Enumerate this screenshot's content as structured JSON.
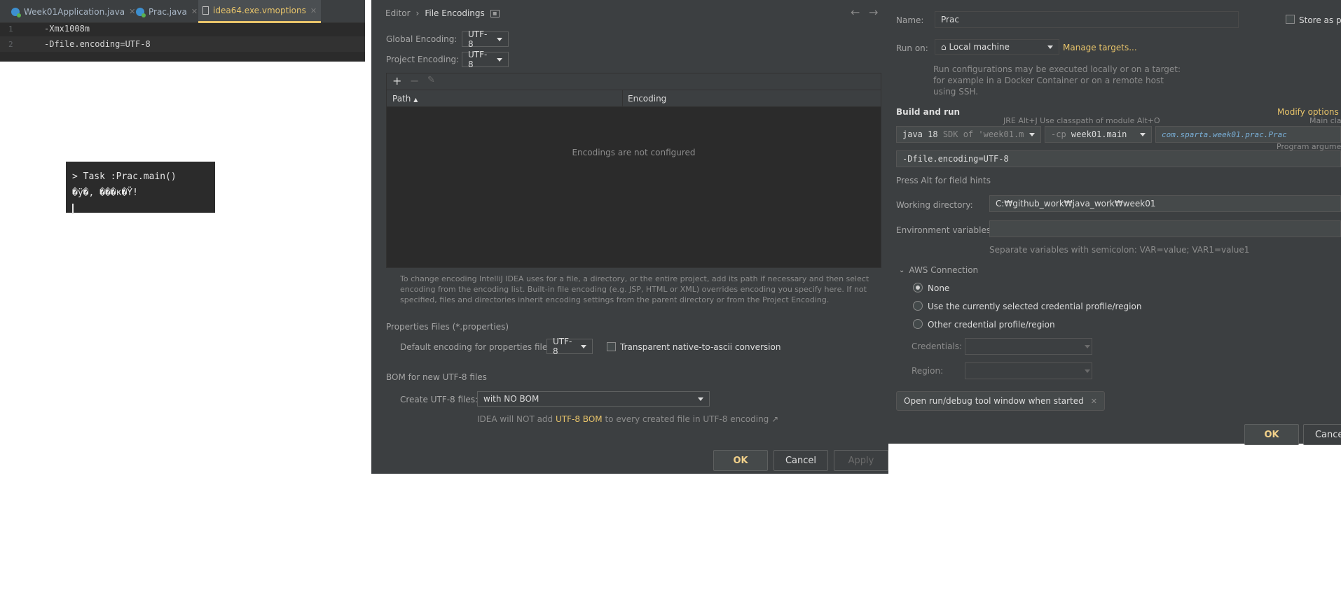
{
  "editor": {
    "tabs": [
      {
        "label": "Week01Application.java",
        "icon": "java-class-icon",
        "active": false
      },
      {
        "label": "Prac.java",
        "icon": "java-class-icon",
        "active": false
      },
      {
        "label": "idea64.exe.vmoptions",
        "icon": "file-icon",
        "active": true
      }
    ],
    "lines": [
      {
        "number": "1",
        "text": "-Xmx1008m"
      },
      {
        "number": "2",
        "text": "-Dfile.encoding=UTF-8"
      }
    ]
  },
  "console": {
    "line1": "> Task :Prac.main()",
    "line2": "�ÿ�, ���κ�Ÿ!"
  },
  "file_encodings": {
    "breadcrumb_parent": "Editor",
    "breadcrumb_sep": "›",
    "title": "File Encodings",
    "global_label": "Global Encoding:",
    "global_value": "UTF-8",
    "project_label": "Project Encoding:",
    "project_value": "UTF-8",
    "table_headers": {
      "path": "Path",
      "encoding": "Encoding"
    },
    "empty_text": "Encodings are not configured",
    "info_text": "To change encoding IntelliJ IDEA uses for a file, a directory, or the entire project, add its path if necessary and then select encoding from the encoding list. Built-in file encoding (e.g. JSP, HTML or XML) overrides encoding you specify here. If not specified, files and directories inherit encoding settings from the parent directory or from the Project Encoding.",
    "properties_section": "Properties Files (*.properties)",
    "properties_label": "Default encoding for properties files:",
    "properties_value": "UTF-8",
    "transparent_label": "Transparent native-to-ascii conversion",
    "bom_section": "BOM for new UTF-8 files",
    "create_label": "Create UTF-8 files:",
    "create_value": "with NO BOM",
    "bom_note_prefix": "IDEA will NOT add",
    "bom_note_link": "UTF-8 BOM",
    "bom_note_suffix": "to every created file in UTF-8 encoding ↗",
    "ok": "OK",
    "cancel": "Cancel",
    "apply": "Apply"
  },
  "run_config": {
    "name_label": "Name:",
    "name_value": "Prac",
    "store_label": "Store as pr",
    "run_on_label": "Run on:",
    "run_on_value": "Local machine",
    "manage_targets": "Manage targets...",
    "run_on_hint": "Run configurations may be executed locally or on a target: for example in a Docker Container or on a remote host using SSH.",
    "build_run_label": "Build and run",
    "modify_options": "Modify options",
    "jre_hint": "JRE Alt+J  Use classpath of module Alt+O",
    "main_class_hint": "Main cla",
    "jre_value": "java 18",
    "jre_detail": "SDK of 'week01.m",
    "cp_prefix": "-cp",
    "cp_value": "week01.main",
    "main_class": "com.sparta.week01.prac.Prac",
    "program_args_hint": "Program argume",
    "vm_options": "-Dfile.encoding=UTF-8",
    "alt_hint": "Press Alt for field hints",
    "working_dir_label": "Working directory:",
    "working_dir_value": "C:₩github_work₩java_work₩week01",
    "env_label": "Environment variables:",
    "env_hint": "Separate variables with semicolon: VAR=value; VAR1=value1",
    "aws_section": "AWS Connection",
    "aws_none": "None",
    "aws_current": "Use the currently selected credential profile/region",
    "aws_other": "Other credential profile/region",
    "credentials_label": "Credentials:",
    "region_label": "Region:",
    "open_tool_window": "Open run/debug tool window when started",
    "ok": "OK",
    "cancel": "Cancel"
  },
  "colors": {
    "dialog_bg": "#3c3f41",
    "editor_bg": "#2b2b2b",
    "accent": "#e8c46a",
    "main_class": "#7ab0d8"
  }
}
